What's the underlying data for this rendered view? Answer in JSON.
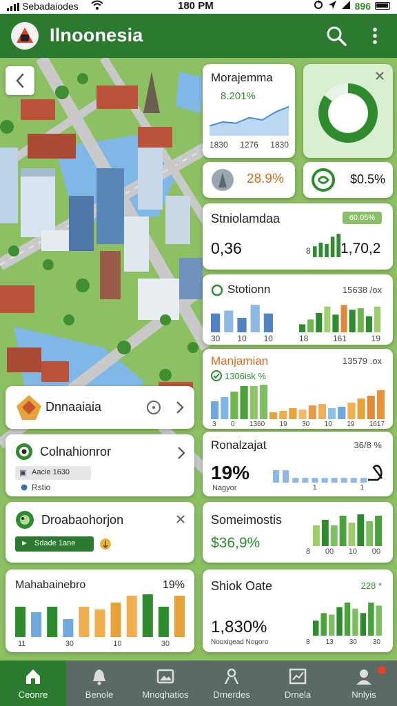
{
  "status_bar": {
    "carrier": "Sebadaiodes",
    "time": "180 PM",
    "battery_pct": "896"
  },
  "app_bar": {
    "title": "Ilnoonesia",
    "icons": [
      "app-logo-icon",
      "search-icon",
      "more-vert-icon"
    ]
  },
  "colors": {
    "primary": "#2b7a2f",
    "accent_orange": "#d86a1e",
    "chart_blue": "#6fa8dc",
    "chart_green": "#2e8b2e"
  },
  "cards": {
    "morajemma": {
      "title": "Morajemma",
      "value": "8.201%",
      "ticks": [
        "1830",
        "1276",
        "1830"
      ]
    },
    "donut": {
      "percent": 0.85
    },
    "stat_a": {
      "value": "28.9%"
    },
    "stat_b": {
      "value": "$0.5%"
    },
    "stniolamdaa": {
      "title": "Stniolamdaa",
      "badge": "60.05%",
      "value": "0,36",
      "value_right": "1,70,2",
      "small": "8"
    },
    "stotionn": {
      "title": "Stotionn",
      "value_right": "15638 /ox",
      "ticks_left": [
        "30",
        "10",
        "10"
      ],
      "ticks_right": [
        "18",
        "161",
        "19"
      ]
    },
    "manjamian": {
      "title": "Manjamian",
      "value_right": "13579 .ox",
      "sub": "1306isk %",
      "ticks": [
        "3",
        "0",
        "1360",
        "19",
        "30",
        "10",
        "19",
        "1617"
      ]
    },
    "ronalzajat": {
      "title": "Ronalzajat",
      "value_right": "36/8 %",
      "value": "19%",
      "sub": "Nagyor",
      "ticks": [
        "1",
        "1"
      ]
    },
    "someimostis": {
      "title": "Someimostis",
      "value": "$36,9%",
      "ticks": [
        "8",
        "00",
        "10",
        "00"
      ]
    },
    "shiok_oate": {
      "title": "Shiok Oate",
      "value_right": "228 *",
      "value": "1,830%",
      "sub": "Nooxigead Nogoro",
      "ticks": [
        "8",
        "13",
        "30",
        "30"
      ]
    },
    "dnnaaiaia": {
      "title": "Dnnaaiaia"
    },
    "colnahionror": {
      "title": "Colnahionror",
      "tag": "Aacie 1630",
      "sub": "Rstio"
    },
    "droabaohorjon": {
      "title": "Droabaohorjon",
      "button": "Sdade 1ane"
    },
    "mahabainebro": {
      "title": "Mahabainebro",
      "value_right": "19%",
      "ticks": [
        "11",
        "30",
        "10",
        "30"
      ]
    }
  },
  "chart_data": [
    {
      "type": "area",
      "title": "Morajemma",
      "values": [
        30,
        42,
        38,
        55,
        48,
        72,
        88
      ]
    },
    {
      "type": "bar",
      "title": "Stniolamdaa",
      "values": [
        15,
        20,
        18,
        28,
        32
      ]
    },
    {
      "type": "bar",
      "title": "Stotionn",
      "values_left": [
        26,
        30,
        20,
        38,
        26
      ],
      "values_right": [
        10,
        16,
        24,
        32,
        22,
        34,
        28,
        30,
        20,
        32
      ]
    },
    {
      "type": "bar",
      "title": "Manjamian",
      "values": [
        26,
        32,
        40,
        48,
        48,
        50,
        10,
        12,
        16,
        14,
        20,
        22,
        16,
        18,
        24,
        30,
        34,
        42
      ]
    },
    {
      "type": "bar",
      "title": "Ronalzajat",
      "values": [
        8,
        8,
        3,
        3,
        3,
        3,
        3,
        3,
        3,
        3
      ]
    },
    {
      "type": "bar",
      "title": "Someimostis",
      "values": [
        30,
        38,
        30,
        44,
        34,
        46,
        36,
        44
      ]
    },
    {
      "type": "bar",
      "title": "Shiok Oate",
      "values": [
        20,
        30,
        28,
        38,
        44,
        36,
        30,
        44,
        40
      ]
    },
    {
      "type": "bar",
      "title": "Mahabainebro",
      "values": [
        44,
        36,
        44,
        26,
        44,
        40,
        50,
        60,
        62,
        44,
        60
      ]
    }
  ],
  "bottom_nav": [
    {
      "label": "Ceonre",
      "icon": "home-icon"
    },
    {
      "label": "Benole",
      "icon": "bell-icon"
    },
    {
      "label": "Mnoqhatios",
      "icon": "photo-icon"
    },
    {
      "label": "Drnerdes",
      "icon": "routes-icon"
    },
    {
      "label": "Drnela",
      "icon": "chart-icon"
    },
    {
      "label": "Nnlyis",
      "icon": "profile-icon"
    }
  ]
}
